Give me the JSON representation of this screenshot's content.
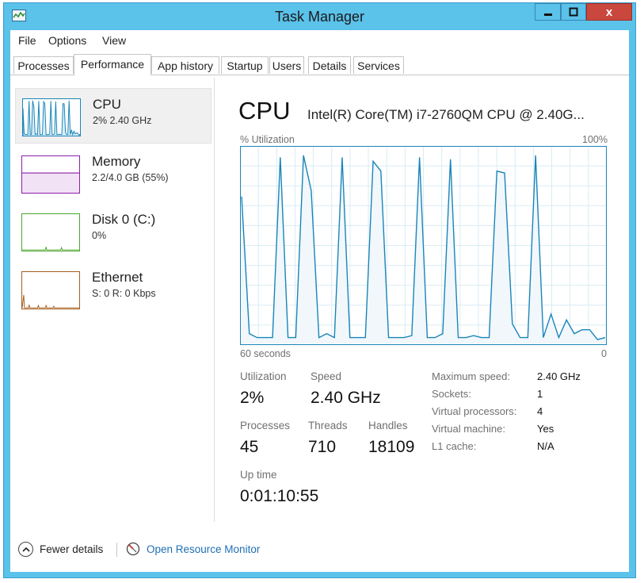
{
  "window": {
    "title": "Task Manager",
    "close_glyph": "x",
    "accent": "#5bc2ea",
    "close_color": "#c9473d"
  },
  "menu": [
    "File",
    "Options",
    "View"
  ],
  "tabs": [
    {
      "label": "Processes",
      "active": false
    },
    {
      "label": "Performance",
      "active": true
    },
    {
      "label": "App history",
      "active": false
    },
    {
      "label": "Startup",
      "active": false
    },
    {
      "label": "Users",
      "active": false
    },
    {
      "label": "Details",
      "active": false
    },
    {
      "label": "Services",
      "active": false
    }
  ],
  "sidebar": [
    {
      "title": "CPU",
      "subtitle": "2%  2.40 GHz",
      "color": "#1a85b8",
      "selected": true
    },
    {
      "title": "Memory",
      "subtitle": "2.2/4.0 GB (55%)",
      "color": "#8b1fa9",
      "selected": false
    },
    {
      "title": "Disk 0 (C:)",
      "subtitle": "0%",
      "color": "#4da62e",
      "selected": false
    },
    {
      "title": "Ethernet",
      "subtitle": "S: 0  R: 0 Kbps",
      "color": "#a75d1f",
      "selected": false
    }
  ],
  "main": {
    "heading": "CPU",
    "model": "Intel(R) Core(TM) i7-2760QM CPU @ 2.40G...",
    "graph_label_left": "% Utilization",
    "graph_label_right": "100%",
    "axis_left": "60 seconds",
    "axis_right": "0",
    "utilization_label": "Utilization",
    "utilization_value": "2%",
    "speed_label": "Speed",
    "speed_value": "2.40 GHz",
    "processes_label": "Processes",
    "processes_value": "45",
    "threads_label": "Threads",
    "threads_value": "710",
    "handles_label": "Handles",
    "handles_value": "18109",
    "uptime_label": "Up time",
    "uptime_value": "0:01:10:55",
    "specs": [
      {
        "label": "Maximum speed:",
        "value": "2.40 GHz"
      },
      {
        "label": "Sockets:",
        "value": "1"
      },
      {
        "label": "Virtual processors:",
        "value": "4"
      },
      {
        "label": "Virtual machine:",
        "value": "Yes"
      },
      {
        "label": "L1 cache:",
        "value": "N/A"
      }
    ]
  },
  "footer": {
    "fewer_details": "Fewer details",
    "open_resource_monitor": "Open Resource Monitor"
  },
  "chart_data": {
    "type": "area",
    "ylim": [
      0,
      100
    ],
    "series": [
      {
        "values": [
          75,
          5,
          3,
          3,
          3,
          95,
          3,
          3,
          96,
          78,
          3,
          5,
          3,
          95,
          3,
          3,
          3,
          93,
          88,
          3,
          3,
          3,
          4,
          95,
          3,
          3,
          5,
          94,
          3,
          3,
          4,
          3,
          3,
          88,
          87,
          10,
          3,
          3,
          96,
          3,
          15,
          3,
          12,
          5,
          7,
          7,
          2,
          3
        ]
      }
    ]
  }
}
